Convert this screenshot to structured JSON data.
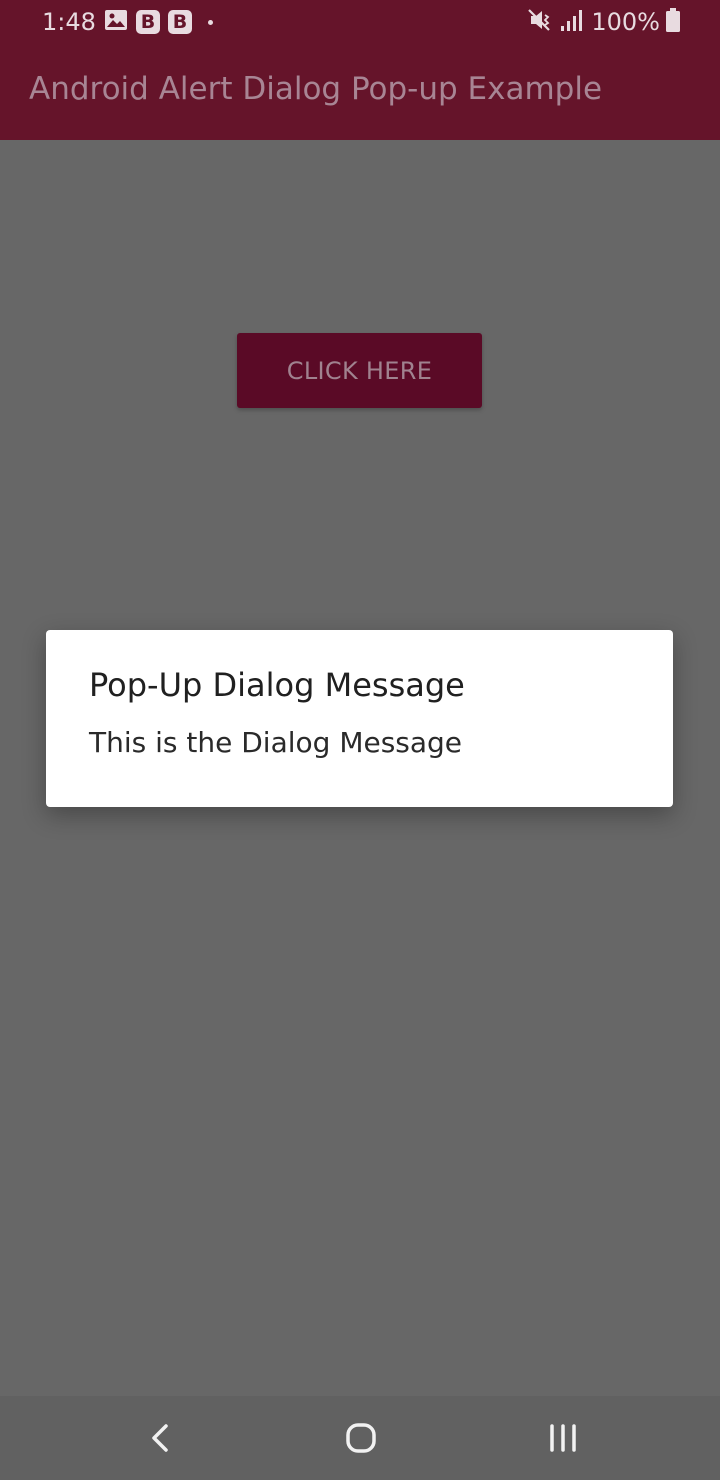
{
  "status_bar": {
    "time": "1:48",
    "badge_1": "B",
    "badge_2": "B",
    "battery_percent": "100%",
    "icons": [
      "image-icon",
      "mute-icon",
      "signal-icon",
      "battery-icon"
    ]
  },
  "app_bar": {
    "title": "Android Alert Dialog Pop-up Example"
  },
  "main": {
    "button_label": "CLICK HERE"
  },
  "dialog": {
    "title": "Pop-Up Dialog Message",
    "message": "This is the Dialog Message"
  },
  "nav_bar": {
    "icons": [
      "back-icon",
      "home-icon",
      "recents-icon"
    ]
  },
  "colors": {
    "primary": "#65142a",
    "scrim_background": "#676767",
    "dialog_background": "#ffffff"
  }
}
